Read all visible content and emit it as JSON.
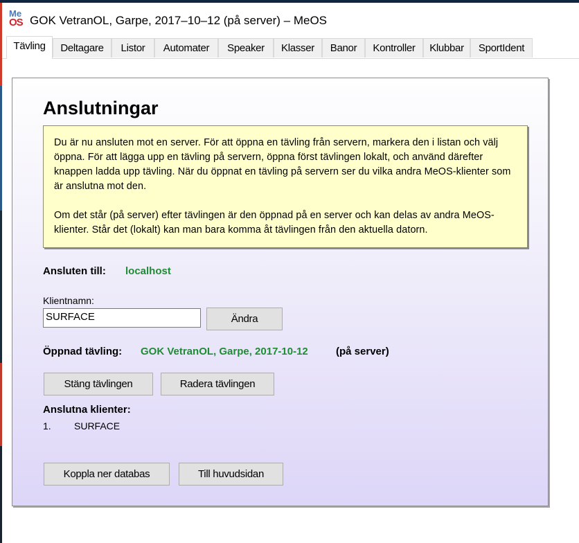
{
  "window": {
    "icon_top": "Me",
    "icon_bottom": "OS",
    "title": "GOK VetranOL, Garpe, 2017–10–12 (på server) – MeOS"
  },
  "tabs": [
    {
      "label": "Tävling",
      "active": true
    },
    {
      "label": "Deltagare"
    },
    {
      "label": "Listor"
    },
    {
      "label": "Automater"
    },
    {
      "label": "Speaker"
    },
    {
      "label": "Klasser"
    },
    {
      "label": "Banor"
    },
    {
      "label": "Kontroller"
    },
    {
      "label": "Klubbar"
    },
    {
      "label": "SportIdent"
    }
  ],
  "main": {
    "heading": "Anslutningar",
    "info_paragraph_1": "Du är nu ansluten mot en server. För att öppna en tävling från servern, markera den i listan och välj öppna. För att lägga upp en tävling på servern, öppna först tävlingen lokalt, och använd därefter knappen ladda upp tävling. När du öppnat en tävling på servern ser du vilka andra MeOS-klienter som är anslutna mot den.",
    "info_paragraph_2": "Om det står (på server) efter tävlingen är den öppnad på en server och kan delas av andra MeOS-klienter. Står det (lokalt) kan man bara komma åt tävlingen från den aktuella datorn.",
    "connected_label": "Ansluten till:",
    "connected_value": "localhost",
    "client_name_label": "Klientnamn:",
    "client_name_value": "SURFACE",
    "change_button": "Ändra",
    "opened_label": "Öppnad tävling:",
    "opened_value": "GOK VetranOL, Garpe, 2017-10-12",
    "opened_suffix": "(på server)",
    "close_button": "Stäng tävlingen",
    "delete_button": "Radera tävlingen",
    "clients_heading": "Anslutna klienter:",
    "clients": [
      {
        "index": "1.",
        "name": "SURFACE"
      }
    ],
    "disconnect_button": "Koppla ner databas",
    "home_button": "Till huvudsidan"
  },
  "colors": {
    "accent_green": "#1e8c32",
    "info_background": "#ffffcc",
    "panel_gradient_end": "#ddd6f8"
  }
}
